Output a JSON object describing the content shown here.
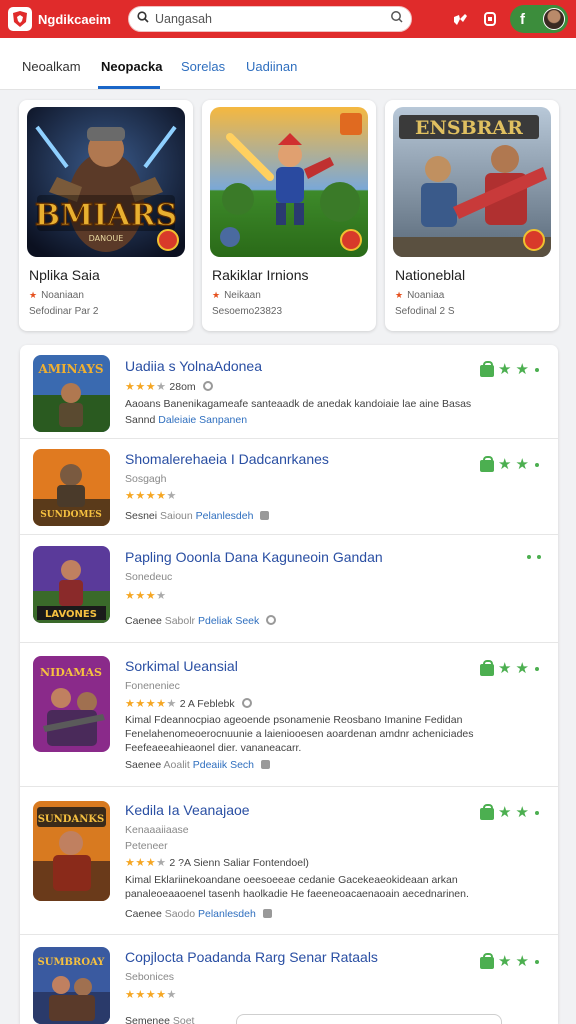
{
  "app": {
    "brand": "Ngdikcaeim"
  },
  "search": {
    "placeholder": "Uangasah"
  },
  "tabs": [
    {
      "label": "Neoalkam"
    },
    {
      "label": "Neopacka"
    },
    {
      "label": "Sorelas"
    },
    {
      "label": "Uadiinan"
    }
  ],
  "featured": [
    {
      "title": "Nplika Saia",
      "dev": "Noaniaan",
      "size": "Sefodinar Par 2",
      "art_text": "BMIARS",
      "art_sub": "DANOUE"
    },
    {
      "title": "Rakiklar Irnions",
      "dev": "Neikaan",
      "size": "Sesoemo23823",
      "art_text": "",
      "art_sub": ""
    },
    {
      "title": "Nationeblal",
      "dev": "Noaniaa",
      "size": "Sefodinal 2 S",
      "art_text": "ENSBRAR",
      "art_sub": ""
    }
  ],
  "list": [
    {
      "title": "Uadiia s YolnaAdonea",
      "rating_text": "28om",
      "stars": 3,
      "desc": [
        "Aaoans Banenikagameafe santeaadk de anedak kandoiaie lae aine Basas"
      ],
      "meta_prefix": "Sannd",
      "meta_dev": "Daleiaie",
      "meta_link": "Sanpanen",
      "art_text": "AMINAYS"
    },
    {
      "title": "Shomalerehaeia I Dadcanrkanes",
      "subtitle": "Sosgagh",
      "stars": 4,
      "desc": [],
      "meta_prefix": "Sesnei",
      "meta_dev": "Saioun",
      "meta_link": "Pelanlesdeh",
      "art_text": "SUNDOMES"
    },
    {
      "title": "Papling Ooonla Dana Kaguneoin Gandan",
      "subtitle": "Sonedeuc",
      "stars": 3,
      "desc": [],
      "meta_prefix": "Caenee",
      "meta_dev": "Sabolr",
      "meta_link": "Pdeliak Seek",
      "art_text": "LAVONES"
    },
    {
      "title": "Sorkimal Ueansial",
      "subtitle": "Foneneniec",
      "rating_text": "2 A Feblebk",
      "stars": 4,
      "desc": [
        "Kimal Fdeannocpiao ageoende psonamenie Reosbano Imanine Fedidan",
        "Fenelahenomeoerocnuunie a laieniooesen aoardenan amdnr acheniciades",
        "Feefeaeeahieaonel dier.           vananeacarr."
      ],
      "meta_prefix": "Saenee",
      "meta_dev": "Aoalit",
      "meta_link": "Pdeaiik Sech",
      "art_text": "NIDAMAS"
    },
    {
      "title": "Kedila Ia Veanajaoe",
      "subtitle": "Kenaaaiiaase",
      "subtitle2": "Peteneer",
      "rating_text": "2 ?A Sienn Saliar Fontendoel)",
      "stars": 3,
      "desc": [
        "Kimal Eklariinekoandane oeesoeeae cedanie Gacekeaeokideaan arkan",
        "panaleoeaaoenel tasenh haolkadie He faeeneoacaenaoain aecednarinen."
      ],
      "meta_prefix": "Caenee",
      "meta_dev": "Saodo",
      "meta_link": "Pelanlesdeh",
      "art_text": "SUNDANKS"
    },
    {
      "title": "Copjlocta Poadanda Rarg Senar Rataals",
      "subtitle": "Sebonices",
      "stars": 4,
      "desc": [],
      "meta_prefix": "Semenee",
      "meta_dev": "Soet",
      "meta_link": "",
      "art_text": "SUMBROAY"
    }
  ]
}
